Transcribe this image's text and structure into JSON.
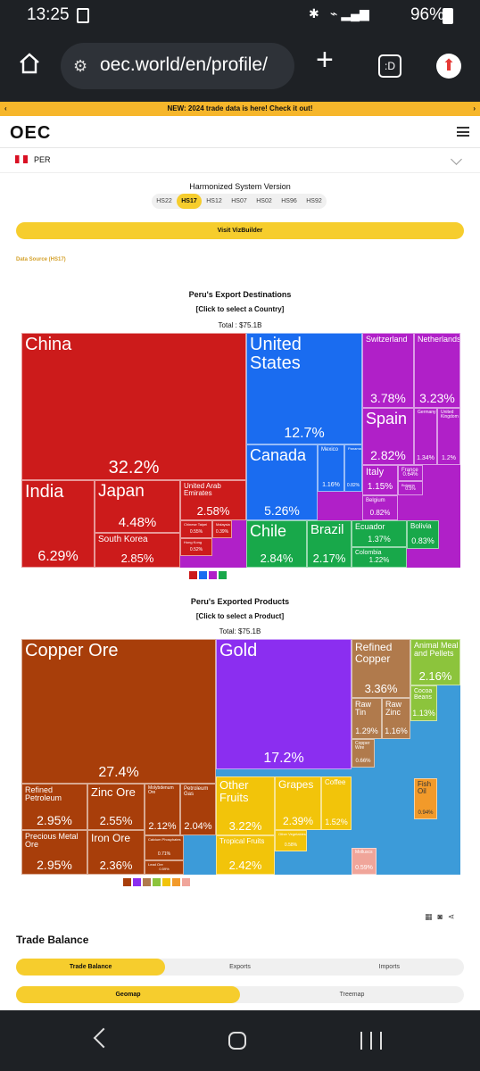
{
  "status_bar": {
    "time": "13:25",
    "battery": "96%"
  },
  "browser": {
    "url": "oec.world/en/profile/",
    "tabs_count": ":D"
  },
  "banner": {
    "text": "NEW: 2024 trade data is here! Check it out!"
  },
  "header": {
    "logo": "OEC"
  },
  "country_select": {
    "value": "PER"
  },
  "hs": {
    "title": "Harmonized System Version",
    "options": [
      "HS22",
      "HS17",
      "HS12",
      "HS07",
      "HS02",
      "HS96",
      "HS92"
    ],
    "selected": "HS17"
  },
  "viz_button": "Visit VizBuilder",
  "data_source": "Data Source (HS17)",
  "destinations": {
    "title": "Peru's Export Destinations",
    "subtitle": "[Click to select a Country]",
    "total": "Total : $75.1B"
  },
  "products": {
    "title": "Peru's Exported Products",
    "subtitle": "[Click to select a Product]",
    "total": "Total: $75.1B"
  },
  "chart_data": [
    {
      "type": "treemap",
      "title": "Peru's Export Destinations",
      "unit": "percent of total exports",
      "items": [
        {
          "name": "China",
          "share": 32.2,
          "color": "#cc1b1b"
        },
        {
          "name": "United States",
          "share": 12.7,
          "color": "#1a6cf0"
        },
        {
          "name": "Canada",
          "share": 5.26,
          "color": "#1a6cf0"
        },
        {
          "name": "India",
          "share": 6.29,
          "color": "#cc1b1b"
        },
        {
          "name": "Japan",
          "share": 4.48,
          "color": "#cc1b1b"
        },
        {
          "name": "South Korea",
          "share": 2.85,
          "color": "#cc1b1b"
        },
        {
          "name": "United Arab Emirates",
          "share": 2.58,
          "color": "#cc1b1b"
        },
        {
          "name": "Switzerland",
          "share": 3.78,
          "color": "#b020c8"
        },
        {
          "name": "Netherlands",
          "share": 3.23,
          "color": "#b020c8"
        },
        {
          "name": "Spain",
          "share": 2.82,
          "color": "#b020c8"
        },
        {
          "name": "Italy",
          "share": 1.15,
          "color": "#b020c8"
        },
        {
          "name": "Germany",
          "share": 1.34,
          "color": "#b020c8"
        },
        {
          "name": "United Kingdom",
          "share": 1.2,
          "color": "#b020c8"
        },
        {
          "name": "France",
          "share": 0.64,
          "color": "#b020c8"
        },
        {
          "name": "Belgium",
          "share": 0.82,
          "color": "#b020c8"
        },
        {
          "name": "Bulgaria",
          "share": 0.5,
          "color": "#b020c8"
        },
        {
          "name": "Chile",
          "share": 2.84,
          "color": "#18a84a"
        },
        {
          "name": "Brazil",
          "share": 2.17,
          "color": "#18a84a"
        },
        {
          "name": "Ecuador",
          "share": 1.37,
          "color": "#18a84a"
        },
        {
          "name": "Colombia",
          "share": 1.22,
          "color": "#18a84a"
        },
        {
          "name": "Bolivia",
          "share": 0.83,
          "color": "#18a84a"
        },
        {
          "name": "Mexico",
          "share": 1.16,
          "color": "#1a6cf0"
        },
        {
          "name": "Panama",
          "share": 0.82,
          "color": "#1a6cf0"
        },
        {
          "name": "Chinese Taipei",
          "share": 0.55,
          "color": "#cc1b1b"
        },
        {
          "name": "Hong Kong",
          "share": 0.52,
          "color": "#cc1b1b"
        },
        {
          "name": "Malaysia",
          "share": 0.39,
          "color": "#cc1b1b"
        }
      ]
    },
    {
      "type": "treemap",
      "title": "Peru's Exported Products",
      "unit": "percent of total exports",
      "items": [
        {
          "name": "Copper Ore",
          "share": 27.4,
          "color": "#a83e0a"
        },
        {
          "name": "Gold",
          "share": 17.2,
          "color": "#8b2ef0"
        },
        {
          "name": "Refined Copper",
          "share": 3.36,
          "color": "#b07a4c"
        },
        {
          "name": "Animal Meal and Pellets",
          "share": 2.16,
          "color": "#8cc43c"
        },
        {
          "name": "Cocoa Beans",
          "share": 1.13,
          "color": "#8cc43c"
        },
        {
          "name": "Raw Tin",
          "share": 1.29,
          "color": "#b07a4c"
        },
        {
          "name": "Raw Zinc",
          "share": 1.16,
          "color": "#b07a4c"
        },
        {
          "name": "Copper Wire",
          "share": 0.66,
          "color": "#b07a4c"
        },
        {
          "name": "Refined Petroleum",
          "share": 2.95,
          "color": "#a83e0a"
        },
        {
          "name": "Zinc Ore",
          "share": 2.55,
          "color": "#a83e0a"
        },
        {
          "name": "Molybdenum Ore",
          "share": 2.12,
          "color": "#a83e0a"
        },
        {
          "name": "Petroleum Gas",
          "share": 2.04,
          "color": "#a83e0a"
        },
        {
          "name": "Precious Metal Ore",
          "share": 2.95,
          "color": "#a83e0a"
        },
        {
          "name": "Iron Ore",
          "share": 2.36,
          "color": "#a83e0a"
        },
        {
          "name": "Calcium Phosphates",
          "share": 0.71,
          "color": "#a83e0a"
        },
        {
          "name": "Other Fruits",
          "share": 3.22,
          "color": "#f2c40a"
        },
        {
          "name": "Grapes",
          "share": 2.39,
          "color": "#f2c40a"
        },
        {
          "name": "Coffee",
          "share": 1.52,
          "color": "#f2c40a"
        },
        {
          "name": "Tropical Fruits",
          "share": 2.42,
          "color": "#f2c40a"
        },
        {
          "name": "Other Vegetables",
          "share": 0.58,
          "color": "#f2c40a"
        },
        {
          "name": "Fish Oil",
          "share": 0.94,
          "color": "#f29a2a"
        },
        {
          "name": "Molluscs",
          "share": 0.59,
          "color": "#f0a59a"
        },
        {
          "name": "Lead Ore",
          "share": 0.59,
          "color": "#a83e0a"
        }
      ]
    }
  ],
  "tools": {
    "icons": [
      "table-icon",
      "camera-icon",
      "share-icon"
    ]
  },
  "trade_balance": {
    "title": "Trade Balance",
    "tabs": [
      "Trade Balance",
      "Exports",
      "Imports"
    ],
    "view_tabs": [
      "Geomap",
      "Treemap"
    ]
  }
}
